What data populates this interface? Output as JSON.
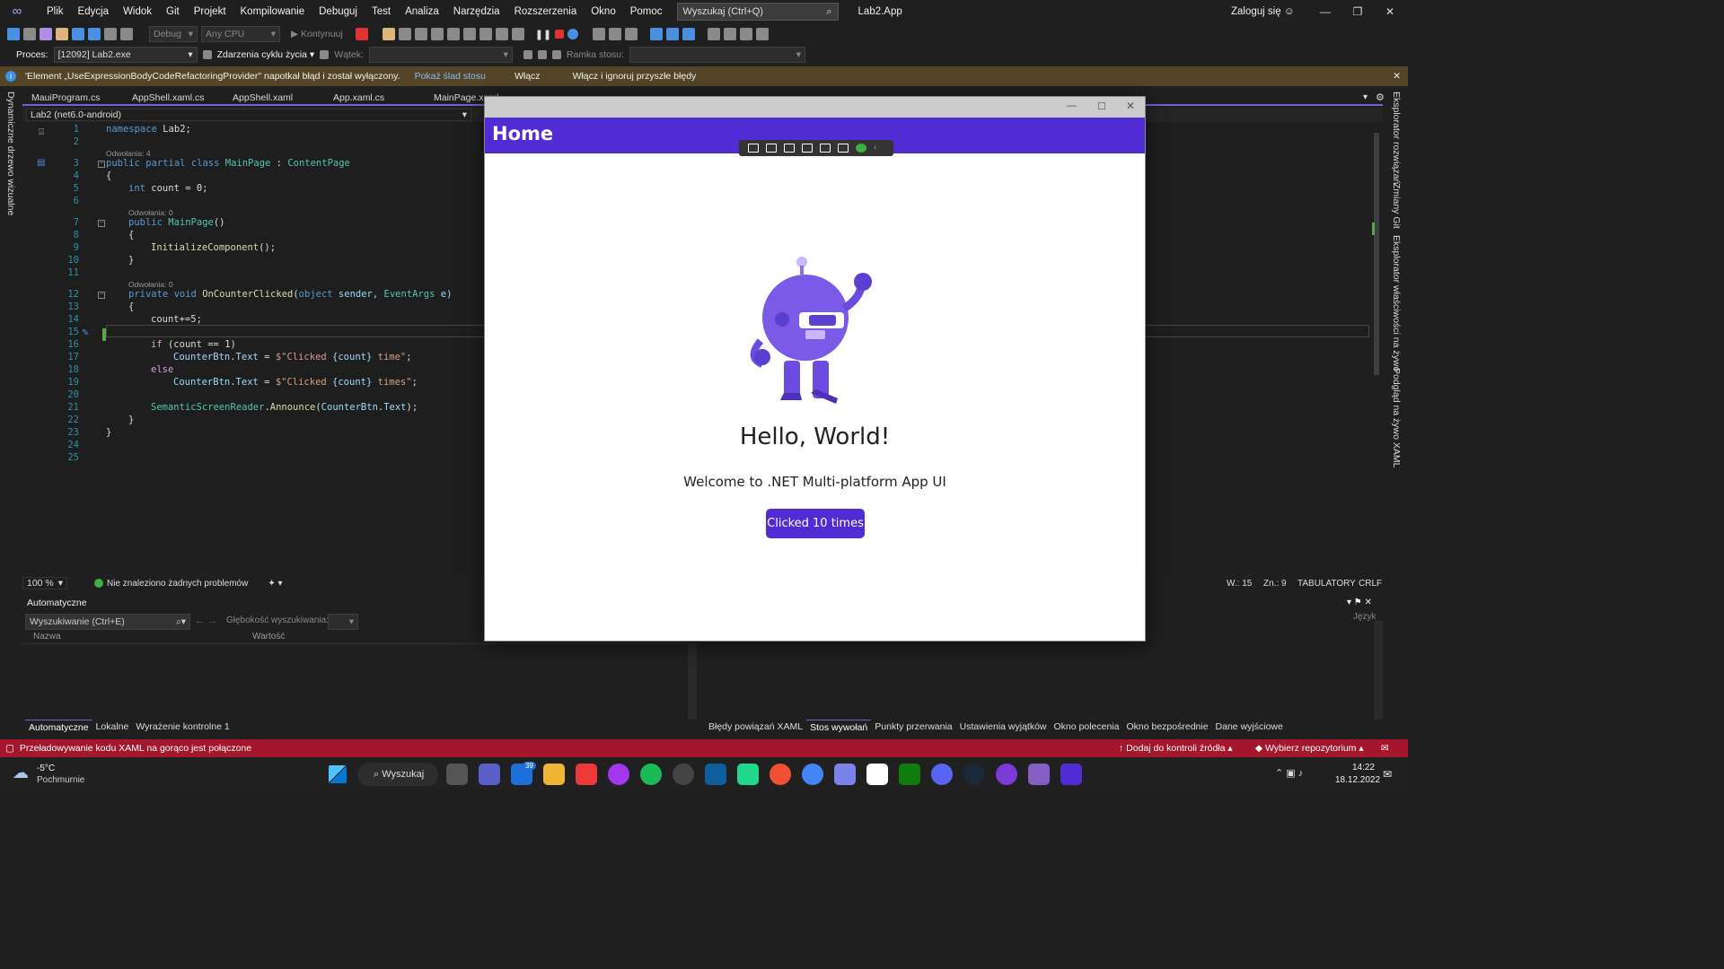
{
  "menu": {
    "items": [
      "Plik",
      "Edycja",
      "Widok",
      "Git",
      "Projekt",
      "Kompilowanie",
      "Debuguj",
      "Test",
      "Analiza",
      "Narzędzia",
      "Rozszerzenia",
      "Okno",
      "Pomoc"
    ]
  },
  "search": {
    "placeholder": "Wyszukaj (Ctrl+Q)"
  },
  "app_title": "Lab2.App",
  "login": "Zaloguj się",
  "toolbar": {
    "config": "Debug",
    "platform": "Any CPU",
    "continue": "Kontynuuj"
  },
  "toolbar2": {
    "process_label": "Proces:",
    "process_value": "[12092] Lab2.exe",
    "lifecycle": "Zdarzenia cyklu życia",
    "thread_label": "Wątek:",
    "stack_label": "Ramka stosu:"
  },
  "infobar": {
    "message": "'Element „UseExpressionBodyCodeRefactoringProvider\" napotkał błąd i został wyłączony.",
    "link1": "Pokaż ślad stosu",
    "link2": "Włącz",
    "link3": "Włącz i ignoruj przyszłe błędy"
  },
  "left_strip": {
    "label": "Dynamiczne drzewo wizualne"
  },
  "right_strip": {
    "labels": [
      "Eksplorator rozwiązań",
      "Zmiany Git",
      "Eksplorator właściwości na żywo",
      "Podgląd na żywo XAML"
    ]
  },
  "tabs": [
    {
      "label": "MauiProgram.cs"
    },
    {
      "label": "AppShell.xaml.cs"
    },
    {
      "label": "AppShell.xaml"
    },
    {
      "label": "App.xaml.cs"
    },
    {
      "label": "MainPage.xaml"
    }
  ],
  "navbar": {
    "project": "Lab2 (net6.0-android)"
  },
  "code": {
    "lines": [
      "1",
      "2",
      "3",
      "4",
      "5",
      "6",
      "7",
      "8",
      "9",
      "10",
      "11",
      "12",
      "13",
      "14",
      "15",
      "16",
      "17",
      "18",
      "19",
      "20",
      "21",
      "22",
      "23",
      "24",
      "25"
    ],
    "lens": {
      "l3": "Odwołania: 4",
      "l7": "Odwołania: 0",
      "l12": "Odwołania: 0"
    },
    "t1": {
      "kw": "namespace",
      "rest": " Lab2;"
    },
    "t3": {
      "a": "public partial class ",
      "b": "MainPage",
      "c": " : ",
      "d": "ContentPage"
    },
    "t4": "{",
    "t5": {
      "kw": "int",
      "rest": " count = 0;"
    },
    "t7": {
      "kw": "public ",
      "fn": "MainPage",
      "rest": "()"
    },
    "t8": "{",
    "t9": {
      "fn": "InitializeComponent",
      "rest": "();"
    },
    "t10": "}",
    "t12": {
      "kw": "private void ",
      "fn": "OnCounterClicked",
      "a": "(",
      "kw2": "object",
      "b": " sender, ",
      "ty": "EventArgs",
      "c": " e)"
    },
    "t13": "{",
    "t14": "count+=5;",
    "t16": {
      "kw": "if",
      "rest": " (count == 1)"
    },
    "t17": {
      "pr": "CounterBtn",
      "a": ".",
      "pr2": "Text",
      "b": " = ",
      "st": "$\"Clicked ",
      "c": "{count}",
      "st2": " time\"",
      "d": ";"
    },
    "t18": {
      "kw": "else"
    },
    "t19": {
      "pr": "CounterBtn",
      "a": ".",
      "pr2": "Text",
      "b": " = ",
      "st": "$\"Clicked ",
      "c": "{count}",
      "st2": " times\"",
      "d": ";"
    },
    "t21": {
      "ty": "SemanticScreenReader",
      "a": ".",
      "fn": "Announce",
      "b": "(",
      "pr": "CounterBtn",
      "c": ".",
      "pr2": "Text",
      "d": ");"
    },
    "t22": "}",
    "t23": "}"
  },
  "editor_status": {
    "zoom": "100 %",
    "issues": "Nie znaleziono żadnych problemów",
    "line": "W.: 15",
    "col": "Zn.: 9",
    "tabs": "TABULATORY",
    "eol": "CRLF"
  },
  "autos": {
    "title": "Automatyczne",
    "search_placeholder": "Wyszukiwanie (Ctrl+E)",
    "depth_label": "Głębokość wyszukiwania:",
    "col_name": "Nazwa",
    "col_value": "Wartość",
    "tabs": [
      "Automatyczne",
      "Lokalne",
      "Wyrażenie kontrolne 1"
    ]
  },
  "callstack": {
    "lang_col": "Język",
    "tabs": [
      "Błędy powiązań XAML",
      "Stos wywołań",
      "Punkty przerwania",
      "Ustawienia wyjątków",
      "Okno polecenia",
      "Okno bezpośrednie",
      "Dane wyjściowe"
    ]
  },
  "statusbar": {
    "message": "Przeładowywanie kodu XAML na gorąco jest połączone",
    "source_control": "Dodaj do kontroli źródła",
    "repo": "Wybierz repozytorium"
  },
  "taskbar": {
    "temp": "-5°C",
    "weather": "Pochmurnie",
    "search": "Wyszukaj",
    "badge": "39",
    "time": "14:22",
    "date": "18.12.2022"
  },
  "maui": {
    "header": "Home",
    "hello": "Hello, World!",
    "welcome": "Welcome to .NET Multi-platform App UI",
    "button": "Clicked 10 times"
  },
  "colors": {
    "accent": "#512bd4",
    "statusbar": "#a4162b",
    "infobar": "#534526",
    "editor_bg": "#1e1e1e"
  }
}
